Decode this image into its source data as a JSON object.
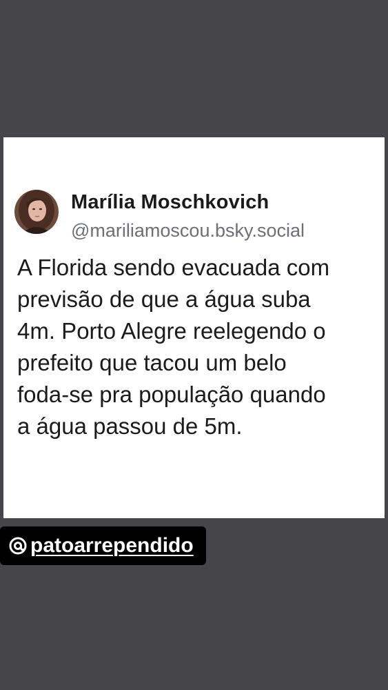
{
  "post": {
    "author": {
      "display_name": "Marília Moschkovich",
      "handle": "@mariliamoscou.bsky.social"
    },
    "text_lines": [
      "A Florida sendo evacuada com",
      "previsão de que a água suba",
      "4m. Porto Alegre reelegendo o",
      "prefeito que tacou um belo",
      "foda-se pra população quando",
      "a água passou de 5m."
    ]
  },
  "sticker": {
    "username": "patoarrependido",
    "icon": "threads-icon"
  },
  "colors": {
    "background": "#464549",
    "card": "#ffffff",
    "handle": "#6b7078",
    "sticker_bg": "#000000"
  }
}
